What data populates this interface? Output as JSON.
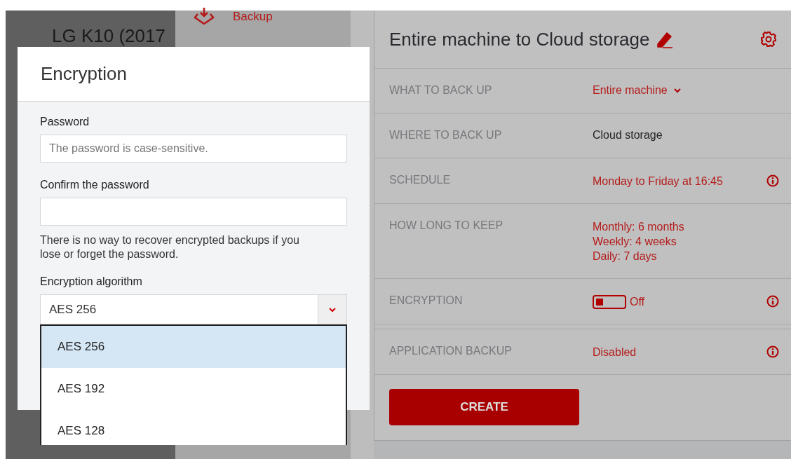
{
  "background": {
    "device_title": "LG K10 (2017",
    "tab": {
      "label": "Backup"
    }
  },
  "plan": {
    "title": "Entire machine to Cloud storage",
    "rows": [
      {
        "label": "WHAT TO BACK UP",
        "kind": "dropdown",
        "values": [
          "Entire machine"
        ],
        "info": false
      },
      {
        "label": "WHERE TO BACK UP",
        "kind": "text",
        "values": [
          "Cloud storage"
        ],
        "info": false
      },
      {
        "label": "SCHEDULE",
        "kind": "link",
        "values": [
          "Monday to Friday at 16:45"
        ],
        "info": true
      },
      {
        "label": "HOW LONG TO KEEP",
        "kind": "link",
        "values": [
          "Monthly: 6 months",
          "Weekly: 4 weeks",
          "Daily: 7 days"
        ],
        "info": false
      },
      {
        "label": "ENCRYPTION",
        "kind": "toggle",
        "on": false,
        "values": [
          "Off"
        ],
        "info": true
      },
      {
        "label": "APPLICATION BACKUP",
        "kind": "link",
        "values": [
          "Disabled"
        ],
        "info": true
      }
    ],
    "create_button": "CREATE"
  },
  "dialog": {
    "title": "Encryption",
    "password": {
      "label": "Password",
      "placeholder": "The password is case-sensitive."
    },
    "confirm": {
      "label": "Confirm the password"
    },
    "note": "There is no way to recover encrypted backups if you lose or forget the password.",
    "algorithm": {
      "label": "Encryption algorithm",
      "value": "AES 256",
      "options": [
        {
          "label": "AES 256",
          "selected": true
        },
        {
          "label": "AES 192",
          "selected": false
        },
        {
          "label": "AES 128",
          "selected": false
        }
      ]
    }
  }
}
